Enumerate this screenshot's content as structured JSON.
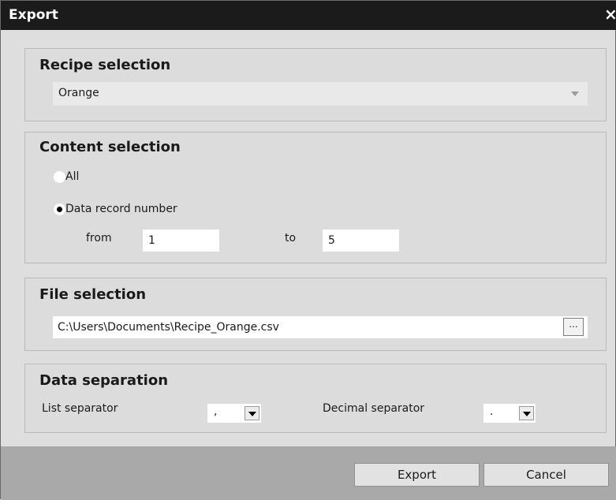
{
  "dialog": {
    "title": "Export",
    "close_glyph": "×"
  },
  "recipe_selection": {
    "title": "Recipe selection",
    "selected": "Orange"
  },
  "content_selection": {
    "title": "Content selection",
    "options": [
      {
        "label": "All",
        "checked": false
      },
      {
        "label": "Data record number",
        "checked": true
      }
    ],
    "from_label": "from",
    "from_value": "1",
    "to_label": "to",
    "to_value": "5"
  },
  "file_selection": {
    "title": "File selection",
    "path": "C:\\Users\\Documents\\Recipe_Orange.csv",
    "browse_label": "..."
  },
  "data_separation": {
    "title": "Data separation",
    "list_separator_label": "List separator",
    "list_separator_value": ",",
    "decimal_separator_label": "Decimal separator",
    "decimal_separator_value": "."
  },
  "buttons": {
    "export": "Export",
    "cancel": "Cancel"
  }
}
